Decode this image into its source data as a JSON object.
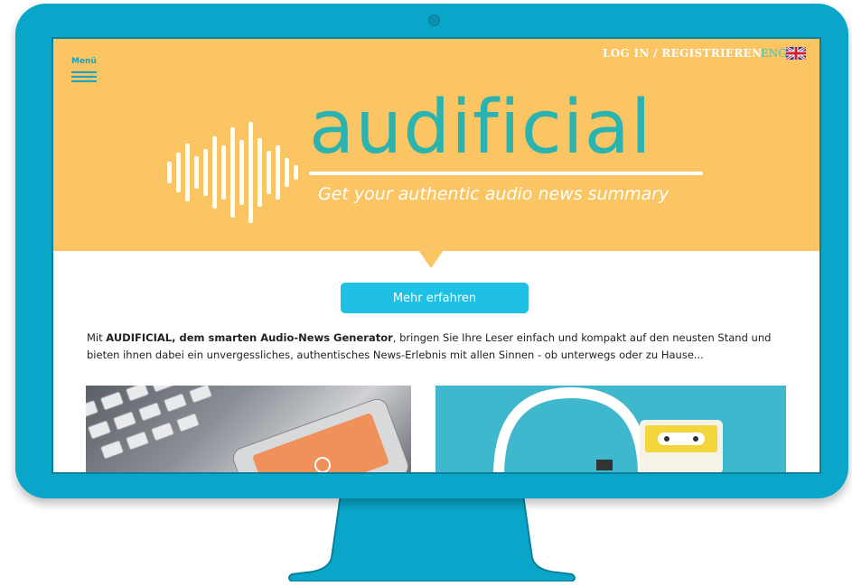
{
  "header": {
    "menu_label": "Menü",
    "login_label": "LOG IN / REGISTRIEREN",
    "lang_label": "ENG"
  },
  "brand": {
    "name": "audificial",
    "tagline": "Get your authentic audio news summary"
  },
  "cta": {
    "label": "Mehr erfahren"
  },
  "intro": {
    "prefix": "Mit ",
    "bold": "AUDIFICIAL, dem smarten Audio-News Generator",
    "rest": ", bringen Sie Ihre Leser einfach und kompakt auf den neusten Stand und bieten ihnen dabei ein unvergessliches, authentisches News-Erlebnis mit allen Sinnen - ob unterwegs oder zu Hause..."
  },
  "colors": {
    "monitor": "#0aa6c9",
    "header_bg": "#fbc563",
    "brand_teal": "#2bb3b0",
    "button": "#1ec0e3"
  },
  "icons": [
    "menu-icon",
    "uk-flag-icon",
    "soundwave-icon",
    "camera-dot"
  ]
}
